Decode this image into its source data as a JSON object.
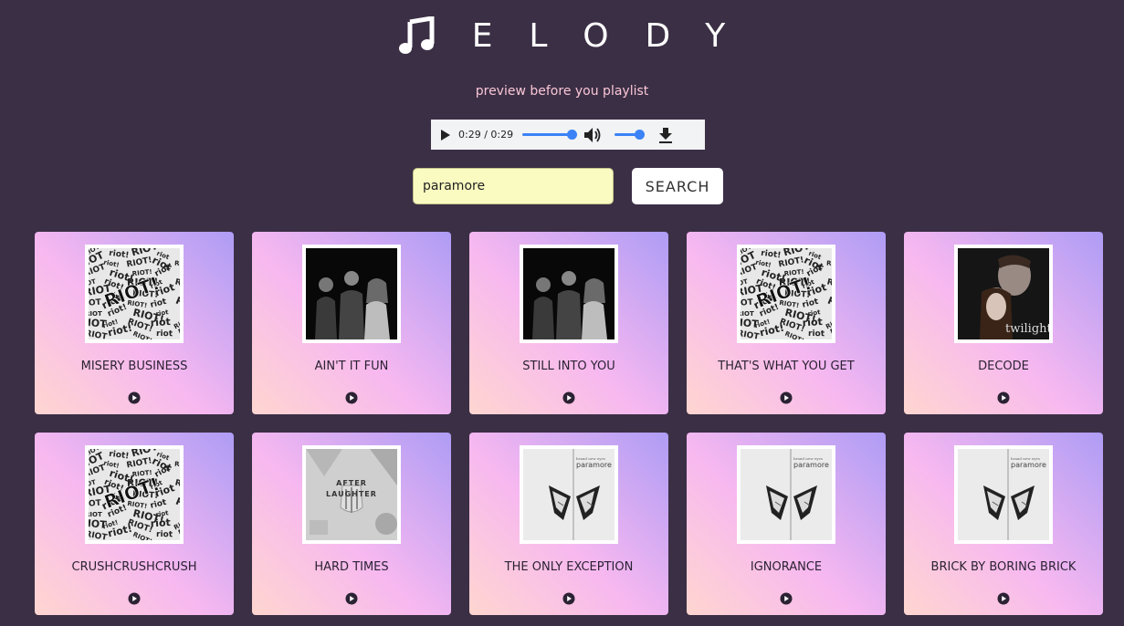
{
  "app": {
    "logo_text": "ELODY",
    "tagline": "preview before you playlist"
  },
  "player": {
    "time": "0:29 / 0:29",
    "progress": 1.0,
    "volume": 1.0
  },
  "search": {
    "value": "paramore",
    "button_label": "SEARCH"
  },
  "songs": [
    {
      "title": "MISERY BUSINESS",
      "art": "riot"
    },
    {
      "title": "AIN'T IT FUN",
      "art": "band"
    },
    {
      "title": "STILL INTO YOU",
      "art": "band"
    },
    {
      "title": "THAT'S WHAT YOU GET",
      "art": "riot"
    },
    {
      "title": "DECODE",
      "art": "twilight"
    },
    {
      "title": "CRUSHCRUSHCRUSH",
      "art": "riot"
    },
    {
      "title": "HARD TIMES",
      "art": "after-laughter"
    },
    {
      "title": "THE ONLY EXCEPTION",
      "art": "butterfly"
    },
    {
      "title": "IGNORANCE",
      "art": "butterfly"
    },
    {
      "title": "BRICK BY BORING BRICK",
      "art": "butterfly"
    }
  ],
  "album_art_text": {
    "twilight": "twilight",
    "after_laughter": "AFTER LAUGHTER",
    "paramore": "paramore",
    "riot": "RIOT!"
  }
}
